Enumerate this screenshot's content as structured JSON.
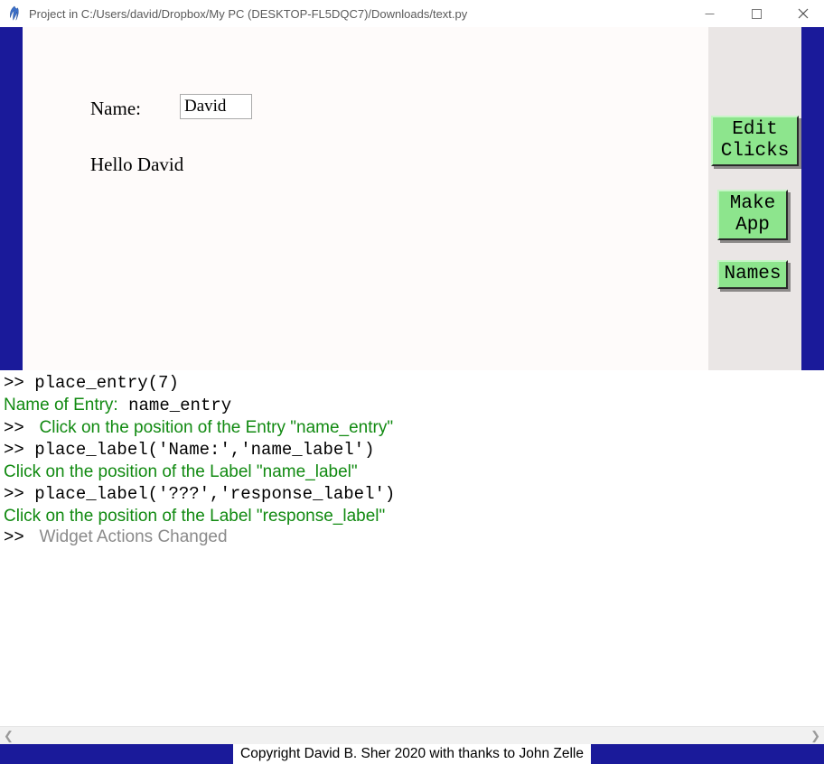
{
  "window": {
    "title": "Project in C:/Users/david/Dropbox/My PC (DESKTOP-FL5DQC7)/Downloads/text.py"
  },
  "app": {
    "name_label": "Name:",
    "name_entry_value": "David",
    "response_label": "Hello David"
  },
  "buttons": {
    "edit_clicks": "Edit\nClicks",
    "make_app": "Make\nApp",
    "names": "Names"
  },
  "console": {
    "lines": [
      {
        "parts": [
          {
            "text": ">> ",
            "cls": "mono black"
          },
          {
            "text": "place_entry(7)",
            "cls": "mono black"
          }
        ]
      },
      {
        "parts": [
          {
            "text": "Name of Entry:",
            "cls": "sans green"
          },
          {
            "text": " ",
            "cls": "mono black"
          },
          {
            "text": "name_entry",
            "cls": "mono black"
          }
        ]
      },
      {
        "parts": [
          {
            "text": ">> ",
            "cls": "mono black"
          },
          {
            "text": " Click on the position of the Entry \"name_entry\"",
            "cls": "sans green"
          }
        ]
      },
      {
        "parts": [
          {
            "text": ">> ",
            "cls": "mono black"
          },
          {
            "text": "place_label('Name:','name_label')",
            "cls": "mono black"
          }
        ]
      },
      {
        "parts": [
          {
            "text": "Click on the position of the Label \"name_label\"",
            "cls": "sans green"
          }
        ]
      },
      {
        "parts": [
          {
            "text": ">> ",
            "cls": "mono black"
          },
          {
            "text": "place_label('???','response_label')",
            "cls": "mono black"
          }
        ]
      },
      {
        "parts": [
          {
            "text": "Click on the position of the Label \"response_label\"",
            "cls": "sans green"
          }
        ]
      },
      {
        "parts": [
          {
            "text": ">> ",
            "cls": "mono black"
          },
          {
            "text": " Widget Actions Changed",
            "cls": "sans gray"
          }
        ]
      }
    ]
  },
  "footer": {
    "copyright": "Copyright David B. Sher 2020 with thanks to John Zelle"
  }
}
